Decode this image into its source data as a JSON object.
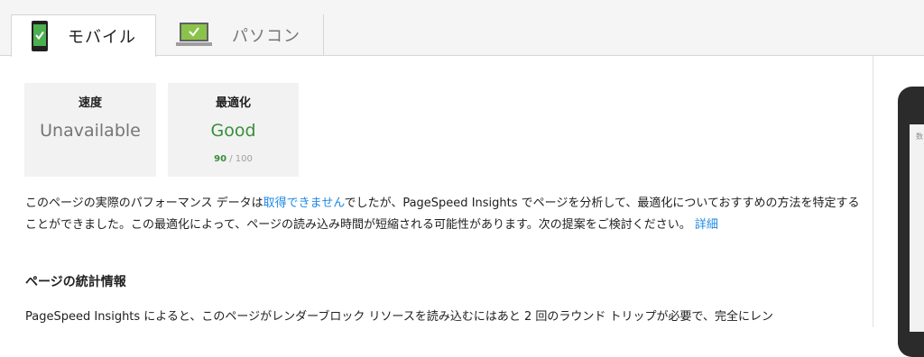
{
  "tabs": [
    {
      "label": "モバイル",
      "icon": "smartphone-icon",
      "active": true
    },
    {
      "label": "パソコン",
      "icon": "laptop-icon",
      "active": false
    }
  ],
  "scores": {
    "speed": {
      "title": "速度",
      "value": "Unavailable"
    },
    "optimization": {
      "title": "最適化",
      "value": "Good",
      "score": "90",
      "max": " / 100"
    }
  },
  "description": {
    "part1": "このページの実際のパフォーマンス データは",
    "link1": "取得できません",
    "part2": "でしたが、PageSpeed Insights でページを分析して、最適化についておすすめの方法を特定することができました。この最適化によって、ページの読み込み時間が短縮される可能性があります。次の提案をご検討ください。",
    "link2": "詳細"
  },
  "section": {
    "heading": "ページの統計情報",
    "text": "PageSpeed Insights によると、このページがレンダーブロック リソースを読み込むにはあと 2 回のラウンド トリップが必要で、完全にレン"
  },
  "preview": {
    "screen_text": "数"
  },
  "colors": {
    "good": "#388e3c",
    "link": "#1e88e5",
    "check": "#4caf50"
  }
}
